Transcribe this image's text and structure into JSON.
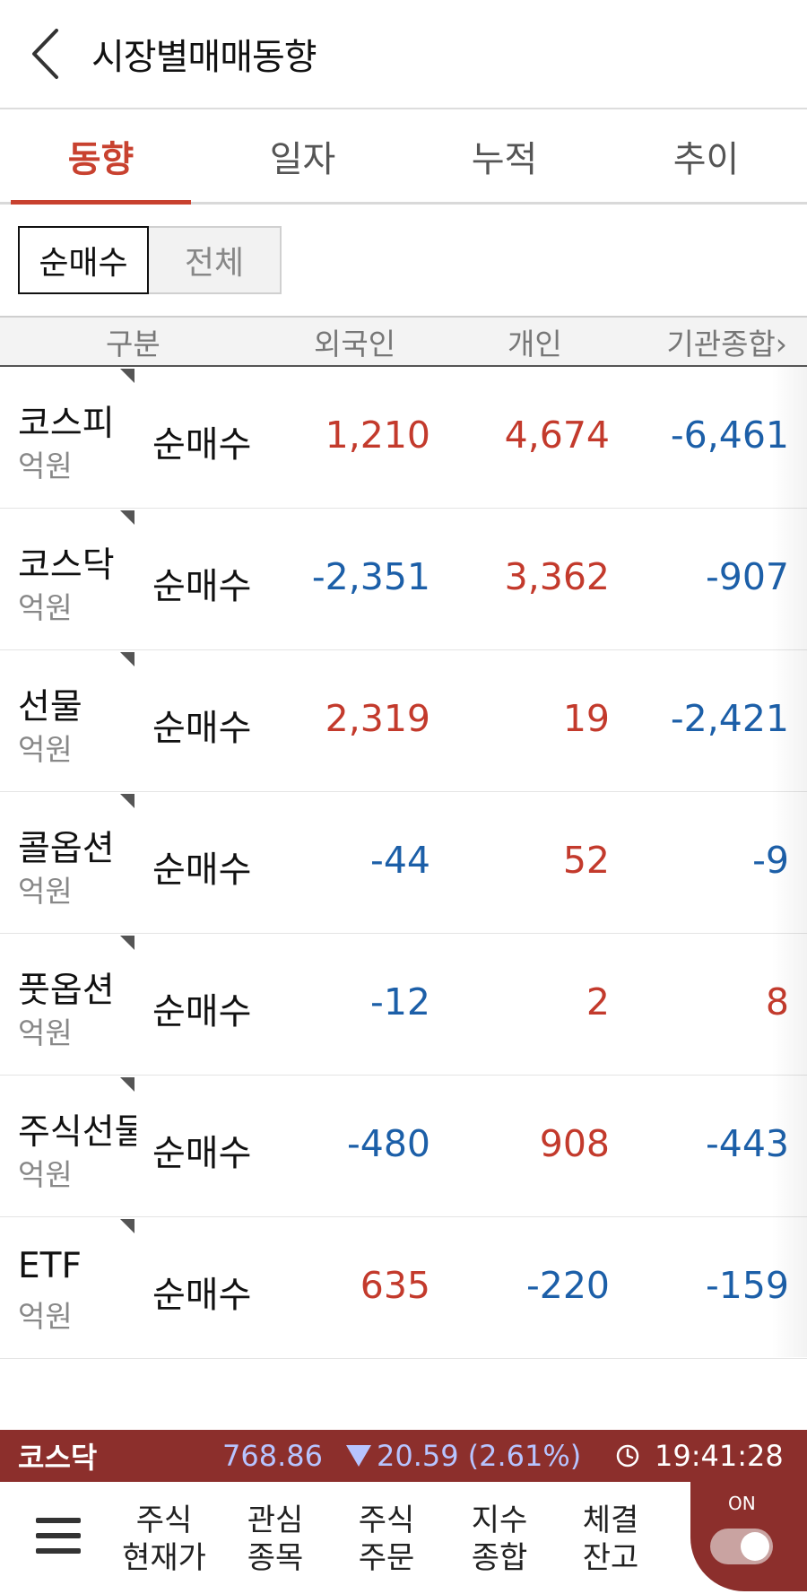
{
  "header": {
    "title": "시장별매매동향",
    "back_icon": "chevron-left-icon"
  },
  "tabs": [
    {
      "label": "동향",
      "active": true
    },
    {
      "label": "일자",
      "active": false
    },
    {
      "label": "누적",
      "active": false
    },
    {
      "label": "추이",
      "active": false
    }
  ],
  "segment": {
    "net_label": "순매수",
    "all_label": "전체",
    "selected": "순매수"
  },
  "table": {
    "headers": {
      "category": "구분",
      "foreign": "외국인",
      "individual": "개인",
      "institution": "기관종합›"
    },
    "rows": [
      {
        "name": "코스피",
        "unit": "억원",
        "type": "순매수",
        "foreign": "1,210",
        "individual": "4,674",
        "institution": "-6,461"
      },
      {
        "name": "코스닥",
        "unit": "억원",
        "type": "순매수",
        "foreign": "-2,351",
        "individual": "3,362",
        "institution": "-907"
      },
      {
        "name": "선물",
        "unit": "억원",
        "type": "순매수",
        "foreign": "2,319",
        "individual": "19",
        "institution": "-2,421"
      },
      {
        "name": "콜옵션",
        "unit": "억원",
        "type": "순매수",
        "foreign": "-44",
        "individual": "52",
        "institution": "-9"
      },
      {
        "name": "풋옵션",
        "unit": "억원",
        "type": "순매수",
        "foreign": "-12",
        "individual": "2",
        "institution": "8"
      },
      {
        "name": "주식선물",
        "unit": "억원",
        "type": "순매수",
        "foreign": "-480",
        "individual": "908",
        "institution": "-443"
      },
      {
        "name": "ETF",
        "unit": "억원",
        "type": "순매수",
        "foreign": "635",
        "individual": "-220",
        "institution": "-159"
      }
    ]
  },
  "ticker": {
    "name": "코스닥",
    "price": "768.86",
    "change": "20.59",
    "percent": "(2.61%)",
    "direction": "down",
    "time": "19:41:28",
    "clock_icon": "clock-icon"
  },
  "bottom_nav": {
    "menu_icon": "hamburger-menu-icon",
    "items": [
      {
        "line1": "주식",
        "line2": "현재가"
      },
      {
        "line1": "관심",
        "line2": "종목"
      },
      {
        "line1": "주식",
        "line2": "주문"
      },
      {
        "line1": "지수",
        "line2": "종합"
      },
      {
        "line1": "체결",
        "line2": "잔고"
      }
    ],
    "toggle_label": "ON",
    "toggle_on": true
  },
  "colors": {
    "positive": "#c33a2c",
    "negative": "#1c5fa8",
    "accent": "#c8412f",
    "ticker_bg": "#8c2f2c"
  }
}
